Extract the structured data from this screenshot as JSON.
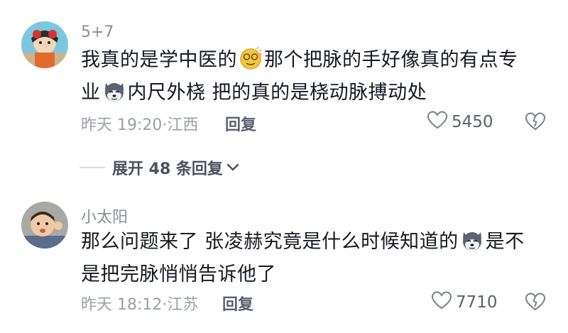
{
  "comments": [
    {
      "username": "5+7",
      "line1_a": "我真的是学中医的",
      "line1_b": "那个把脉的手好像真的有点专",
      "line2_a": "业",
      "line2_b": "内尺外桡 把的真的是桡动脉搏动处",
      "time_location": "昨天 19:20·江西",
      "reply_label": "回复",
      "likes": "5450",
      "emojis": [
        "dizzy-face-emoji",
        "husky-dog-emoji"
      ]
    },
    {
      "username": "小太阳",
      "line1_a": "那么问题来了 张凌赫究竟是什么时候知道的",
      "line1_b": "是不",
      "line2_a": "是把完脉悄悄告诉他了",
      "time_location": "昨天 18:12·江苏",
      "reply_label": "回复",
      "likes": "7710",
      "emojis": [
        "husky-dog-emoji"
      ]
    }
  ],
  "expand_replies_label": "展开 48 条回复",
  "icons": {
    "like": "heart-outline-icon",
    "dislike": "broken-heart-icon",
    "expand": "chevron-down-icon"
  },
  "colors": {
    "text": "#161823",
    "meta": "#9aa0a8",
    "action": "#5b606b"
  }
}
